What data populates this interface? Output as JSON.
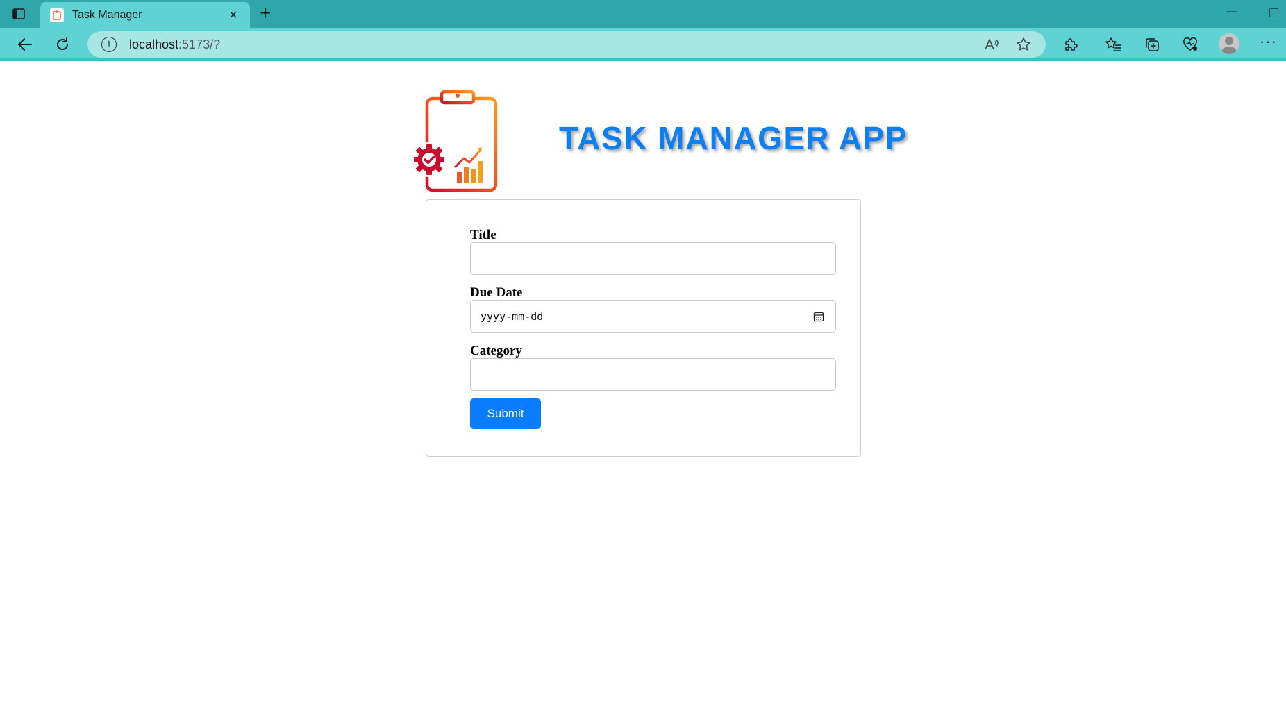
{
  "browser": {
    "tab_title": "Task Manager",
    "address_host": "localhost",
    "address_path": ":5173/?",
    "icons": {
      "tab_actions": "tab-actions-icon",
      "favicon": "clipboard-favicon",
      "close": "close-icon",
      "new_tab": "plus-icon",
      "back": "back-arrow-icon",
      "refresh": "refresh-icon",
      "site_info": "info-icon",
      "read_aloud": "read-aloud-icon",
      "favorite": "star-icon",
      "extensions": "puzzle-icon",
      "favorites": "favorites-icon",
      "collections": "collections-icon",
      "health": "heart-icon",
      "profile": "avatar-icon",
      "more": "more-icon"
    },
    "colors": {
      "tabstrip": "#2ea6aa",
      "toolbar": "#5fd3d3",
      "address_bar": "#a8e6e6"
    }
  },
  "page": {
    "app_title": "TASK MANAGER APP",
    "title_color": "#0d7ff0",
    "form": {
      "title_label": "Title",
      "title_value": "",
      "due_date_label": "Due Date",
      "due_date_placeholder": "yyyy-mm-dd",
      "category_label": "Category",
      "category_value": "",
      "submit_label": "Submit",
      "submit_color": "#0a7cff"
    }
  }
}
